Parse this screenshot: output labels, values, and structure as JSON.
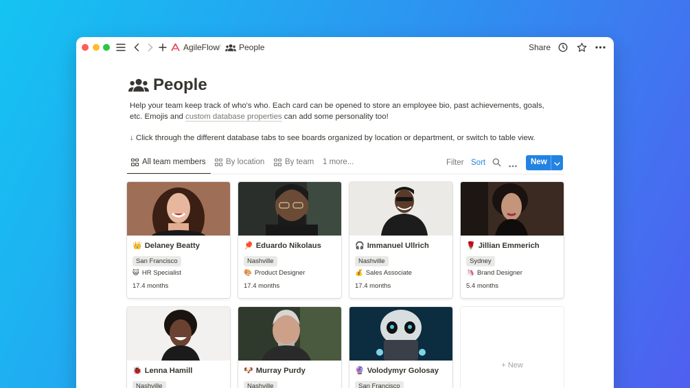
{
  "topbar": {
    "workspace": "AgileFlow",
    "separator": "/",
    "page": "People",
    "share": "Share"
  },
  "header": {
    "title": "People",
    "description_1": "Help your team keep track of who's who. Each card can be opened to store an employee bio, past achievements, goals, etc. Emojis and ",
    "description_link": "custom database properties",
    "description_2": " can add some personality too!",
    "instruction": "↓ Click through the different database tabs to see boards organized by location or department, or switch to table view."
  },
  "tabs": [
    {
      "label": "All team members"
    },
    {
      "label": "By location"
    },
    {
      "label": "By team"
    },
    {
      "label": "1 more..."
    }
  ],
  "toolbar": {
    "filter": "Filter",
    "sort": "Sort",
    "new": "New"
  },
  "colors": {
    "accent": "#2383e2",
    "text": "#37352f",
    "muted": "#787774"
  },
  "cards": [
    {
      "emoji": "👑",
      "name": "Delaney Beatty",
      "location": "San Francisco",
      "role_emoji": "😺",
      "role": "HR Specialist",
      "tenure": "17.4 months",
      "photo_icon": "woman-smiling-photo"
    },
    {
      "emoji": "🏓",
      "name": "Eduardo Nikolaus",
      "location": "Nashville",
      "role_emoji": "🎨",
      "role": "Product Designer",
      "tenure": "17.4 months",
      "photo_icon": "man-glasses-photo"
    },
    {
      "emoji": "🎧",
      "name": "Immanuel Ullrich",
      "location": "Nashville",
      "role_emoji": "💰",
      "role": "Sales Associate",
      "tenure": "17.4 months",
      "photo_icon": "man-sunglasses-photo"
    },
    {
      "emoji": "🌹",
      "name": "Jillian Emmerich",
      "location": "Sydney",
      "role_emoji": "🦄",
      "role": "Brand Designer",
      "tenure": "5.4 months",
      "photo_icon": "woman-dark-photo"
    },
    {
      "emoji": "🐞",
      "name": "Lenna Hamill",
      "location": "Nashville",
      "photo_icon": "woman-laughing-photo"
    },
    {
      "emoji": "🐶",
      "name": "Murray Purdy",
      "location": "Nashville",
      "photo_icon": "man-gray-hair-photo"
    },
    {
      "emoji": "🔮",
      "name": "Volodymyr Golosay",
      "location": "San Francisco",
      "photo_icon": "alien-laptop-photo"
    }
  ],
  "new_card": {
    "label": "+ New"
  }
}
